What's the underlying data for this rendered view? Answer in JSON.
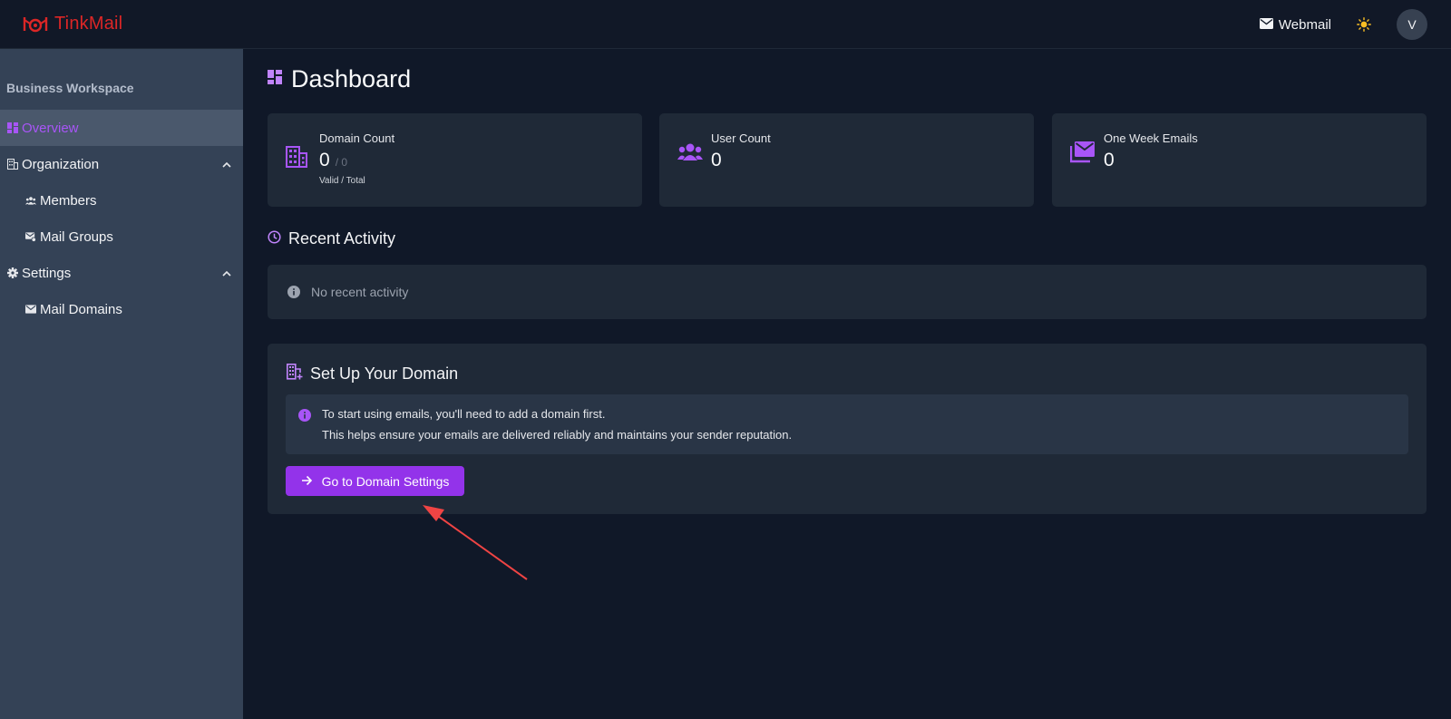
{
  "header": {
    "brand_name": "TinkMail",
    "webmail_label": "Webmail",
    "avatar_initial": "V"
  },
  "sidebar": {
    "workspace_title": "Business Workspace",
    "items": [
      {
        "label": "Overview",
        "icon": "dashboard-icon",
        "active": true
      },
      {
        "label": "Organization",
        "icon": "building-icon",
        "expanded": true
      },
      {
        "label": "Members",
        "icon": "users-icon"
      },
      {
        "label": "Mail Groups",
        "icon": "mail-group-icon"
      },
      {
        "label": "Settings",
        "icon": "gear-icon",
        "expanded": true
      },
      {
        "label": "Mail Domains",
        "icon": "mail-icon"
      }
    ]
  },
  "main": {
    "page_title": "Dashboard",
    "stats": [
      {
        "label": "Domain Count",
        "value": "0",
        "total": "/ 0",
        "sublabel": "Valid / Total",
        "icon": "building-icon"
      },
      {
        "label": "User Count",
        "value": "0",
        "icon": "users-icon"
      },
      {
        "label": "One Week Emails",
        "value": "0",
        "icon": "mail-icon"
      }
    ],
    "recent_activity": {
      "title": "Recent Activity",
      "empty_text": "No recent activity"
    },
    "setup": {
      "title": "Set Up Your Domain",
      "line1": "To start using emails, you'll need to add a domain first.",
      "line2": "This helps ensure your emails are delivered reliably and maintains your sender reputation.",
      "button_label": "Go to Domain Settings"
    }
  },
  "colors": {
    "accent": "#a855f7",
    "button": "#9333ea",
    "brand": "#dc2626",
    "annotation": "#ef4444"
  }
}
